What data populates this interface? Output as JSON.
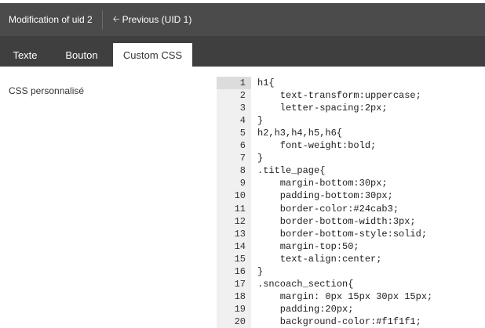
{
  "header": {
    "title": "Modification of uid 2",
    "prev_label": "Previous (UID 1)",
    "prev_icon": "arrow-left-icon"
  },
  "tabs": [
    {
      "label": "Texte",
      "active": false
    },
    {
      "label": "Bouton",
      "active": false
    },
    {
      "label": "Custom CSS",
      "active": true
    }
  ],
  "field": {
    "label": "CSS personnalisé"
  },
  "editor": {
    "active_line": 1,
    "lines": [
      {
        "n": "1",
        "text": "h1{"
      },
      {
        "n": "2",
        "text": "    text-transform:uppercase;"
      },
      {
        "n": "3",
        "text": "    letter-spacing:2px;"
      },
      {
        "n": "4",
        "text": "}"
      },
      {
        "n": "5",
        "text": "h2,h3,h4,h5,h6{"
      },
      {
        "n": "6",
        "text": "    font-weight:bold;"
      },
      {
        "n": "7",
        "text": "}"
      },
      {
        "n": "8",
        "text": ".title_page{"
      },
      {
        "n": "9",
        "text": "    margin-bottom:30px;"
      },
      {
        "n": "10",
        "text": "    padding-bottom:30px;"
      },
      {
        "n": "11",
        "text": "    border-color:#24cab3;"
      },
      {
        "n": "12",
        "text": "    border-bottom-width:3px;"
      },
      {
        "n": "13",
        "text": "    border-bottom-style:solid;"
      },
      {
        "n": "14",
        "text": "    margin-top:50;"
      },
      {
        "n": "15",
        "text": "    text-align:center;"
      },
      {
        "n": "16",
        "text": "}"
      },
      {
        "n": "17",
        "text": ".sncoach_section{"
      },
      {
        "n": "18",
        "text": "    margin: 0px 15px 30px 15px;"
      },
      {
        "n": "19",
        "text": "    padding:20px;"
      },
      {
        "n": "20",
        "text": "    background-color:#f1f1f1;"
      }
    ]
  }
}
